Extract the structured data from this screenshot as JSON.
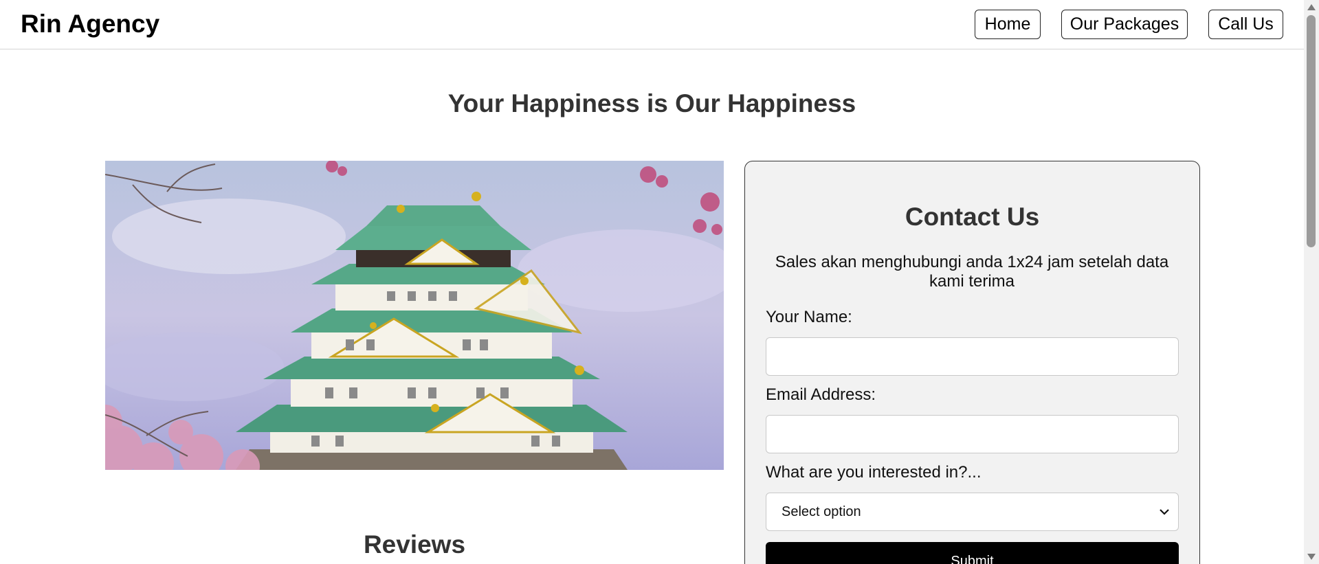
{
  "header": {
    "brand": "Rin Agency",
    "nav": {
      "home": "Home",
      "packages": "Our Packages",
      "call": "Call Us"
    }
  },
  "hero": {
    "title": "Your Happiness is Our Happiness",
    "image_icon": "castle-photo"
  },
  "reviews": {
    "title": "Reviews"
  },
  "contact": {
    "title": "Contact Us",
    "description": "Sales akan menghubungi anda 1x24 jam setelah data kami terima",
    "name_label": "Your Name:",
    "name_value": "",
    "email_label": "Email Address:",
    "email_value": "",
    "interest_label": "What are you interested in?...",
    "interest_selected": "Select option",
    "submit_label": "Submit"
  },
  "colors": {
    "submit_bg": "#000000",
    "card_bg": "#f2f2f2",
    "heading": "#333333"
  }
}
